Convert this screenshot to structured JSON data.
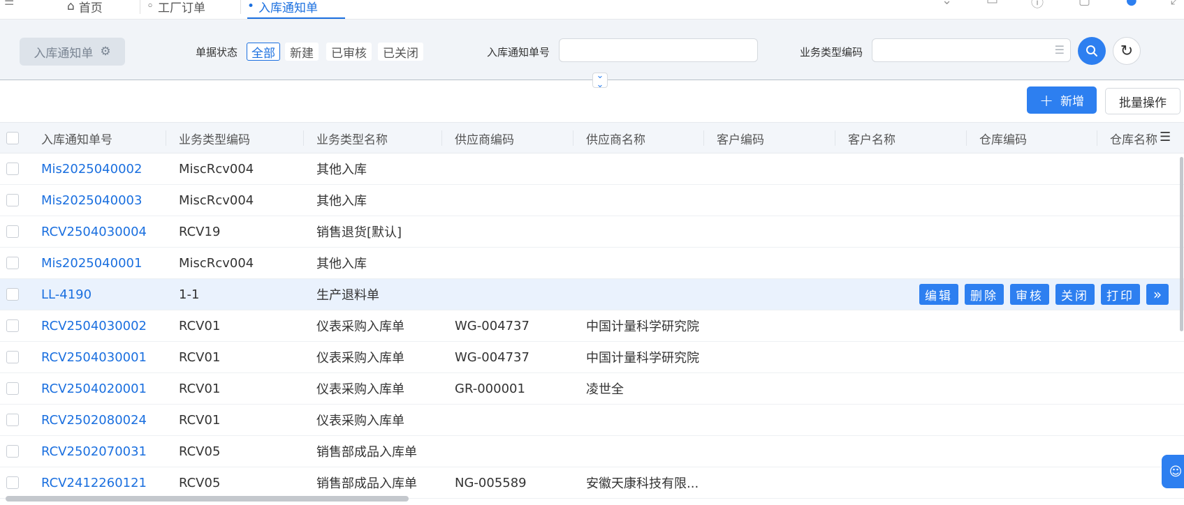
{
  "top_tabs": [
    {
      "label": "首页",
      "icon": "home-icon"
    },
    {
      "label": "工厂订单",
      "icon": "document-icon"
    },
    {
      "label": "入库通知单",
      "icon": "dot-icon",
      "active": true
    }
  ],
  "filter": {
    "title": "入库通知单",
    "status_label": "单据状态",
    "status_options": [
      "全部",
      "新建",
      "已审核",
      "已关闭"
    ],
    "active_status": "全部",
    "notice_no_label": "入库通知单号",
    "notice_no_value": "",
    "biz_type_label": "业务类型编码",
    "biz_type_value": ""
  },
  "actions": {
    "add_label": "新增",
    "batch_label": "批量操作"
  },
  "table": {
    "columns": [
      "入库通知单号",
      "业务类型编码",
      "业务类型名称",
      "供应商编码",
      "供应商名称",
      "客户编码",
      "客户名称",
      "仓库编码",
      "仓库名称"
    ],
    "rows": [
      {
        "no": "Mis2025040002",
        "biz_code": "MiscRcv004",
        "biz_name": "其他入库",
        "supplier_code": "",
        "supplier_name": ""
      },
      {
        "no": "Mis2025040003",
        "biz_code": "MiscRcv004",
        "biz_name": "其他入库",
        "supplier_code": "",
        "supplier_name": ""
      },
      {
        "no": "RCV2504030004",
        "biz_code": "RCV19",
        "biz_name": "销售退货[默认]",
        "supplier_code": "",
        "supplier_name": ""
      },
      {
        "no": "Mis2025040001",
        "biz_code": "MiscRcv004",
        "biz_name": "其他入库",
        "supplier_code": "",
        "supplier_name": ""
      },
      {
        "no": "LL-4190",
        "biz_code": "1-1",
        "biz_name": "生产退料单",
        "supplier_code": "",
        "supplier_name": ""
      },
      {
        "no": "RCV2504030002",
        "biz_code": "RCV01",
        "biz_name": "仪表采购入库单",
        "supplier_code": "WG-004737",
        "supplier_name": "中国计量科学研究院"
      },
      {
        "no": "RCV2504030001",
        "biz_code": "RCV01",
        "biz_name": "仪表采购入库单",
        "supplier_code": "WG-004737",
        "supplier_name": "中国计量科学研究院"
      },
      {
        "no": "RCV2504020001",
        "biz_code": "RCV01",
        "biz_name": "仪表采购入库单",
        "supplier_code": "GR-000001",
        "supplier_name": "凌世全"
      },
      {
        "no": "RCV2502080024",
        "biz_code": "RCV01",
        "biz_name": "仪表采购入库单",
        "supplier_code": "",
        "supplier_name": ""
      },
      {
        "no": "RCV2502070031",
        "biz_code": "RCV05",
        "biz_name": "销售部成品入库单",
        "supplier_code": "",
        "supplier_name": ""
      },
      {
        "no": "RCV2412260121",
        "biz_code": "RCV05",
        "biz_name": "销售部成品入库单",
        "supplier_code": "NG-005589",
        "supplier_name": "安徽天康科技有限..."
      }
    ],
    "row_actions": [
      "编辑",
      "删除",
      "审核",
      "关闭",
      "打印",
      "»"
    ]
  }
}
